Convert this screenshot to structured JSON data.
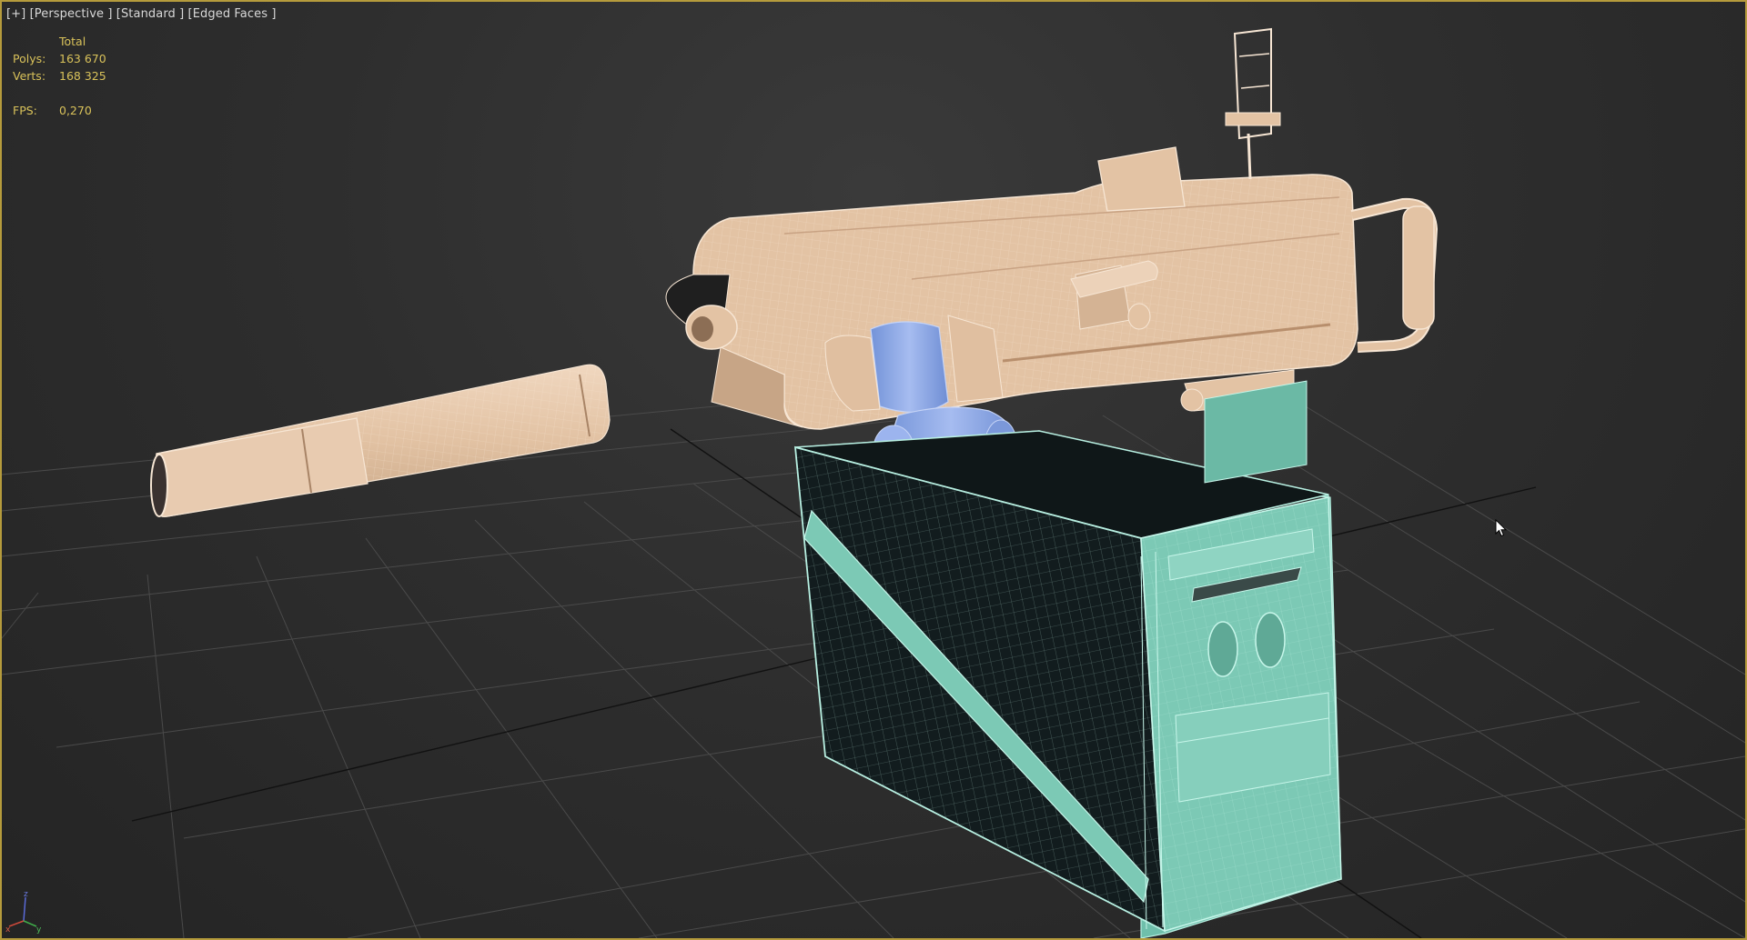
{
  "viewport": {
    "label_items": [
      "[+]",
      "[Perspective ]",
      "[Standard ]",
      "[Edged Faces ]"
    ]
  },
  "stats": {
    "header": "Total",
    "polys_label": "Polys:",
    "polys_value": "163 670",
    "verts_label": "Verts:",
    "verts_value": "168 325",
    "fps_label": "FPS:",
    "fps_value": "0,270"
  },
  "gizmo": {
    "z": "z",
    "x": "x",
    "y": "y"
  },
  "colors": {
    "viewport_border": "#b59b3c",
    "stats_text": "#d9c25a",
    "gun_fill": "#e3c3a4",
    "gun_wire": "#f5e2cf",
    "ammo_box_fill": "#7cc9b5",
    "ammo_box_inner": "#151d1e",
    "ammo_box_wire": "#b8f0e2",
    "belt_fill": "#8ba6e6",
    "grid_line": "#4a4a4a",
    "grid_axis": "#111111"
  },
  "scene": {
    "objects": [
      "grenade-launcher",
      "ammo-belt",
      "ammo-box"
    ],
    "selected": "ammo-box"
  }
}
